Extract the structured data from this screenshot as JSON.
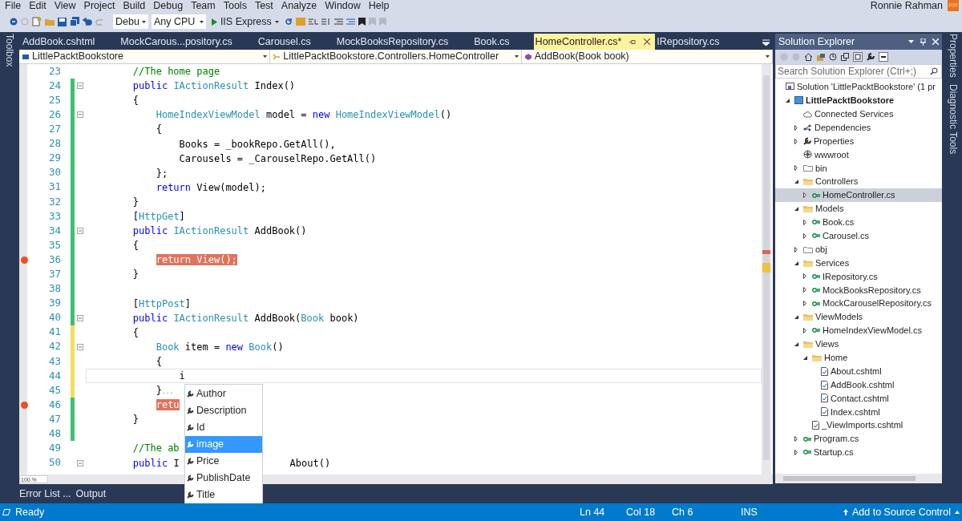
{
  "menu": [
    "File",
    "Edit",
    "View",
    "Project",
    "Build",
    "Debug",
    "Team",
    "Tools",
    "Test",
    "Analyze",
    "Window",
    "Help"
  ],
  "user": {
    "name": "Ronnie Rahman",
    "initials": "RR"
  },
  "toolbar": {
    "configuration": "Debu",
    "platform": "Any CPU",
    "run_target": "IIS Express"
  },
  "side_tabs_left": [
    "Toolbox"
  ],
  "tabs": [
    {
      "label": "AddBook.cshtml",
      "selected": false
    },
    {
      "label": "MockCarous...pository.cs",
      "selected": false
    },
    {
      "label": "Carousel.cs",
      "selected": false
    },
    {
      "label": "MockBooksRepository.cs",
      "selected": false
    },
    {
      "label": "Book.cs",
      "selected": false
    },
    {
      "label": "HomeController.cs*",
      "selected": true
    },
    {
      "label": "IRepository.cs",
      "selected": false
    }
  ],
  "nav_bar": [
    "LittlePacktBookstore",
    "LittlePacktBookstore.Controllers.HomeController",
    "AddBook(Book book)"
  ],
  "code_lines": [
    {
      "number": "23",
      "changed": false,
      "saved": false,
      "fold": false,
      "breakpoint": false,
      "current": false,
      "tokens": [
        {
          "kind": "comment",
          "text": "//The home page"
        }
      ]
    },
    {
      "number": "24",
      "changed": true,
      "saved": true,
      "fold": true,
      "breakpoint": false,
      "current": false,
      "tokens": [
        {
          "kind": "keyword",
          "text": "public "
        },
        {
          "kind": "type",
          "text": "IActionResult"
        },
        {
          "kind": "plain",
          "text": " Index()"
        }
      ]
    },
    {
      "number": "25",
      "changed": true,
      "saved": true,
      "fold": false,
      "breakpoint": false,
      "current": false,
      "tokens": [
        {
          "kind": "plain",
          "text": "{"
        }
      ],
      "children": [
        {
          "number": "26",
          "changed": true,
          "saved": true,
          "fold": true,
          "breakpoint": false,
          "current": false,
          "tokens": [
            {
              "kind": "type",
              "text": "HomeIndexViewModel"
            },
            {
              "kind": "plain",
              "text": " model = "
            },
            {
              "kind": "keyword",
              "text": "new "
            },
            {
              "kind": "type",
              "text": "HomeIndexViewModel"
            },
            {
              "kind": "plain",
              "text": "()"
            }
          ]
        },
        {
          "number": "27",
          "changed": true,
          "saved": true,
          "fold": false,
          "breakpoint": false,
          "current": false,
          "tokens": [
            {
              "kind": "plain",
              "text": "{"
            }
          ],
          "children": [
            {
              "number": "28",
              "changed": true,
              "saved": true,
              "fold": false,
              "breakpoint": false,
              "current": false,
              "tokens": [
                {
                  "kind": "plain",
                  "text": "Books = _bookRepo.GetAll(),"
                }
              ]
            },
            {
              "number": "29",
              "changed": true,
              "saved": true,
              "fold": false,
              "breakpoint": false,
              "current": false,
              "tokens": [
                {
                  "kind": "plain",
                  "text": "Carousels = _CarouselRepo.GetAll()"
                }
              ]
            }
          ]
        },
        {
          "number": "30",
          "changed": true,
          "saved": true,
          "fold": false,
          "breakpoint": false,
          "current": false,
          "tokens": [
            {
              "kind": "plain",
              "text": "};"
            }
          ]
        },
        {
          "number": "31",
          "changed": true,
          "saved": true,
          "fold": false,
          "breakpoint": false,
          "current": false,
          "tokens": [
            {
              "kind": "keyword",
              "text": "return "
            },
            {
              "kind": "plain",
              "text": "View(model);"
            }
          ]
        }
      ]
    },
    {
      "number": "32",
      "changed": true,
      "saved": true,
      "fold": false,
      "breakpoint": false,
      "current": false,
      "tokens": [
        {
          "kind": "plain",
          "text": "}"
        }
      ]
    },
    {
      "number": "33",
      "changed": true,
      "saved": true,
      "fold": false,
      "breakpoint": false,
      "current": false,
      "tokens": [
        {
          "kind": "plain",
          "text": "["
        },
        {
          "kind": "type",
          "text": "HttpGet"
        },
        {
          "kind": "plain",
          "text": "]"
        }
      ]
    },
    {
      "number": "34",
      "changed": true,
      "saved": true,
      "fold": true,
      "breakpoint": false,
      "current": false,
      "tokens": [
        {
          "kind": "keyword",
          "text": "public "
        },
        {
          "kind": "type",
          "text": "IActionResult"
        },
        {
          "kind": "plain",
          "text": " AddBook()"
        }
      ]
    },
    {
      "number": "35",
      "changed": true,
      "saved": true,
      "fold": false,
      "breakpoint": false,
      "current": false,
      "tokens": [
        {
          "kind": "plain",
          "text": "{"
        }
      ],
      "children": [
        {
          "number": "36",
          "changed": true,
          "saved": true,
          "fold": false,
          "breakpoint": true,
          "current": false,
          "tokens": [
            {
              "kind": "breakpoint",
              "text": "return View();"
            }
          ]
        }
      ]
    },
    {
      "number": "37",
      "changed": true,
      "saved": true,
      "fold": false,
      "breakpoint": false,
      "current": false,
      "tokens": [
        {
          "kind": "plain",
          "text": "}"
        }
      ]
    },
    {
      "number": "38",
      "changed": true,
      "saved": true,
      "fold": false,
      "breakpoint": false,
      "current": false
    },
    {
      "number": "39",
      "changed": true,
      "saved": true,
      "fold": false,
      "breakpoint": false,
      "current": false,
      "tokens": [
        {
          "kind": "plain",
          "text": "["
        },
        {
          "kind": "type",
          "text": "HttpPost"
        },
        {
          "kind": "plain",
          "text": "]"
        }
      ]
    },
    {
      "number": "40",
      "changed": true,
      "saved": true,
      "fold": true,
      "breakpoint": false,
      "current": false,
      "tokens": [
        {
          "kind": "keyword",
          "text": "public "
        },
        {
          "kind": "type",
          "text": "IActionResult"
        },
        {
          "kind": "plain",
          "text": " AddBook("
        },
        {
          "kind": "type",
          "text": "Book"
        },
        {
          "kind": "plain",
          "text": " book)"
        }
      ]
    },
    {
      "number": "41",
      "changed": true,
      "saved": false,
      "fold": false,
      "breakpoint": false,
      "current": false,
      "tokens": [
        {
          "kind": "plain",
          "text": "{"
        }
      ],
      "children": [
        {
          "number": "42",
          "changed": true,
          "saved": false,
          "fold": true,
          "breakpoint": false,
          "current": false,
          "tokens": [
            {
              "kind": "type",
              "text": "Book"
            },
            {
              "kind": "plain",
              "text": " item = "
            },
            {
              "kind": "keyword",
              "text": "new "
            },
            {
              "kind": "type",
              "text": "Book"
            },
            {
              "kind": "plain",
              "text": "()"
            }
          ]
        },
        {
          "number": "43",
          "changed": true,
          "saved": false,
          "fold": false,
          "breakpoint": false,
          "current": false,
          "tokens": [
            {
              "kind": "plain",
              "text": "{"
            }
          ],
          "children": [
            {
              "number": "44",
              "changed": true,
              "saved": false,
              "fold": false,
              "breakpoint": false,
              "current": true,
              "tokens": [
                {
                  "kind": "plain",
                  "text": "i"
                }
              ]
            }
          ]
        },
        {
          "number": "45",
          "changed": true,
          "saved": false,
          "fold": false,
          "breakpoint": false,
          "current": false,
          "tokens": [
            {
              "kind": "plain",
              "text": "}"
            },
            {
              "kind": "hint",
              "text": "..."
            }
          ]
        },
        {
          "number": "46",
          "changed": true,
          "saved": true,
          "fold": false,
          "breakpoint": true,
          "current": false,
          "tokens": [
            {
              "kind": "breakpoint",
              "text": "retu"
            }
          ]
        }
      ]
    },
    {
      "number": "47",
      "changed": true,
      "saved": true,
      "fold": false,
      "breakpoint": false,
      "current": false,
      "tokens": [
        {
          "kind": "plain",
          "text": "}"
        }
      ]
    },
    {
      "number": "48",
      "changed": true,
      "saved": true,
      "fold": false,
      "breakpoint": false,
      "current": false
    },
    {
      "number": "49",
      "changed": false,
      "saved": false,
      "fold": false,
      "breakpoint": false,
      "current": false,
      "tokens": [
        {
          "kind": "comment",
          "text": "//The ab"
        }
      ]
    },
    {
      "number": "50",
      "changed": false,
      "saved": false,
      "fold": true,
      "breakpoint": false,
      "current": false,
      "tokens": [
        {
          "kind": "keyword",
          "text": "public "
        },
        {
          "kind": "plain",
          "text": "I"
        },
        {
          "kind": "beyond_popup",
          "text": "About()"
        }
      ]
    }
  ],
  "completion": {
    "items": [
      {
        "label": "Author",
        "selected": false
      },
      {
        "label": "Description",
        "selected": false
      },
      {
        "label": "Id",
        "selected": false
      },
      {
        "label": "image",
        "selected": true
      },
      {
        "label": "Price",
        "selected": false
      },
      {
        "label": "PublishDate",
        "selected": false
      },
      {
        "label": "Title",
        "selected": false
      }
    ]
  },
  "zoom": "100 %",
  "bottom_tabs": [
    "Error List ...",
    "Output"
  ],
  "solution_explorer": {
    "title": "Solution Explorer",
    "search": {
      "placeholder": "Search Solution Explorer (Ctrl+;)"
    },
    "tree": [
      {
        "label": "Solution 'LittlePacktBookstore' (1 pr",
        "kind": "solution",
        "bold": false,
        "selected": false,
        "children": [
          {
            "label": "LittlePacktBookstore",
            "kind": "project",
            "expanded": true,
            "bold": true,
            "selected": false,
            "children": [
              {
                "label": "Connected Services",
                "kind": "service",
                "bold": false,
                "selected": false
              },
              {
                "label": "Dependencies",
                "kind": "dependency",
                "expanded": false,
                "bold": false,
                "selected": false
              },
              {
                "label": "Properties",
                "kind": "settings",
                "expanded": false,
                "bold": false,
                "selected": false
              },
              {
                "label": "wwwroot",
                "kind": "web",
                "bold": false,
                "selected": false
              },
              {
                "label": "bin",
                "kind": "hidden_folder",
                "expanded": false,
                "bold": false,
                "selected": false
              },
              {
                "label": "Controllers",
                "kind": "folder",
                "expanded": true,
                "bold": false,
                "selected": false,
                "children": [
                  {
                    "label": "HomeController.cs",
                    "kind": "code",
                    "expanded": false,
                    "bold": false,
                    "selected": true
                  }
                ]
              },
              {
                "label": "Models",
                "kind": "folder",
                "expanded": true,
                "bold": false,
                "selected": false,
                "children": [
                  {
                    "label": "Book.cs",
                    "kind": "code",
                    "expanded": false,
                    "bold": false,
                    "selected": false
                  },
                  {
                    "label": "Carousel.cs",
                    "kind": "code",
                    "expanded": false,
                    "bold": false,
                    "selected": false
                  }
                ]
              },
              {
                "label": "obj",
                "kind": "hidden_folder",
                "expanded": false,
                "bold": false,
                "selected": false
              },
              {
                "label": "Services",
                "kind": "folder",
                "expanded": true,
                "bold": false,
                "selected": false,
                "children": [
                  {
                    "label": "IRepository.cs",
                    "kind": "code",
                    "expanded": false,
                    "bold": false,
                    "selected": false
                  },
                  {
                    "label": "MockBooksRepository.cs",
                    "kind": "code",
                    "expanded": false,
                    "bold": false,
                    "selected": false
                  },
                  {
                    "label": "MockCarouselRepository.cs",
                    "kind": "code",
                    "expanded": false,
                    "bold": false,
                    "selected": false
                  }
                ]
              },
              {
                "label": "ViewModels",
                "kind": "folder",
                "expanded": true,
                "bold": false,
                "selected": false,
                "children": [
                  {
                    "label": "HomeIndexViewModel.cs",
                    "kind": "code",
                    "expanded": false,
                    "bold": false,
                    "selected": false
                  }
                ]
              },
              {
                "label": "Views",
                "kind": "folder",
                "expanded": true,
                "bold": false,
                "selected": false,
                "children": [
                  {
                    "label": "Home",
                    "kind": "folder",
                    "expanded": true,
                    "bold": false,
                    "selected": false,
                    "children": [
                      {
                        "label": "About.cshtml",
                        "kind": "view",
                        "bold": false,
                        "selected": false
                      },
                      {
                        "label": "AddBook.cshtml",
                        "kind": "view",
                        "bold": false,
                        "selected": false
                      },
                      {
                        "label": "Contact.cshtml",
                        "kind": "view",
                        "bold": false,
                        "selected": false
                      },
                      {
                        "label": "Index.cshtml",
                        "kind": "view",
                        "bold": false,
                        "selected": false
                      }
                    ]
                  },
                  {
                    "label": "_ViewImports.cshtml",
                    "kind": "view",
                    "bold": false,
                    "selected": false
                  }
                ]
              },
              {
                "label": "Program.cs",
                "kind": "code",
                "expanded": false,
                "bold": false,
                "selected": false
              },
              {
                "label": "Startup.cs",
                "kind": "code",
                "expanded": false,
                "bold": false,
                "selected": false
              }
            ]
          }
        ]
      }
    ]
  },
  "side_tabs_right": [
    "Properties",
    "Diagnostic Tools"
  ],
  "status_bar": {
    "state": "Ready",
    "line": "Ln 44",
    "column": "Col 18",
    "char": "Ch 6",
    "mode": "INS",
    "source_control": "Add to Source Control"
  }
}
